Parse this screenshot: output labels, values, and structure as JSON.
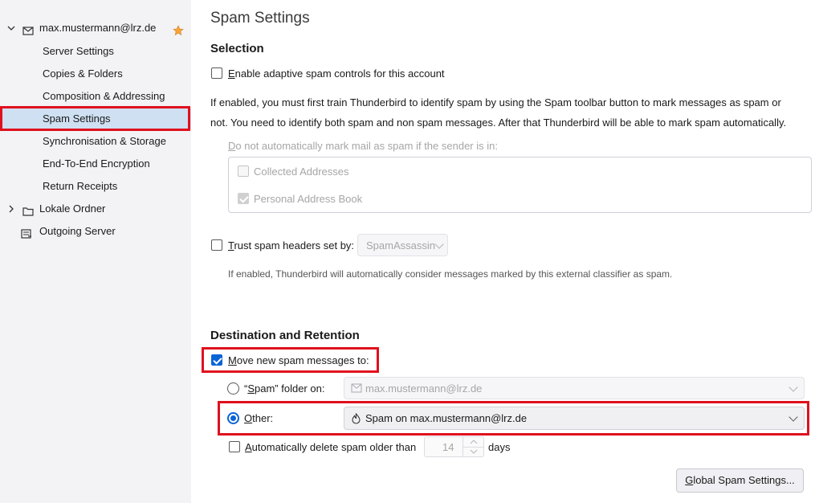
{
  "sidebar": {
    "account": "max.mustermann@lrz.de",
    "items": [
      {
        "label": "Server Settings"
      },
      {
        "label": "Copies & Folders"
      },
      {
        "label": "Composition & Addressing"
      },
      {
        "label": "Spam Settings"
      },
      {
        "label": "Synchronisation & Storage"
      },
      {
        "label": "End-To-End Encryption"
      },
      {
        "label": "Return Receipts"
      }
    ],
    "local_folders": "Lokale Ordner",
    "outgoing_server": "Outgoing Server"
  },
  "page": {
    "title": "Spam Settings",
    "selection": {
      "heading": "Selection",
      "enable_adaptive_prefix": "E",
      "enable_adaptive_rest": "nable adaptive spam controls for this account",
      "desc_line1": "If enabled, you must first train Thunderbird to identify spam by using the Spam toolbar button to mark messages as spam or",
      "desc_line2": "not. You need to identify both spam and non spam messages. After that Thunderbird will be able to mark spam automatically.",
      "whitelist_prefix": "D",
      "whitelist_rest": "o not automatically mark mail as spam if the sender is in:",
      "collected": "Collected Addresses",
      "personal": "Personal Address Book",
      "trust_prefix": "T",
      "trust_rest": "rust spam headers set by:",
      "trust_select": "SpamAssassin",
      "trust_desc": "If enabled, Thunderbird will automatically consider messages marked by this external classifier as spam."
    },
    "destination": {
      "heading": "Destination and Retention",
      "move_prefix": "M",
      "move_rest": "ove new spam messages to:",
      "spam_folder_pre": "“",
      "spam_folder_u": "S",
      "spam_folder_rest": "pam” folder on:",
      "spam_folder_select": "max.mustermann@lrz.de",
      "other_u": "O",
      "other_rest": "ther:",
      "other_select": "Spam on max.mustermann@lrz.de",
      "auto_delete_pre": "A",
      "auto_delete_rest": "utomatically delete spam older than",
      "days_value": "14",
      "days_label": "days",
      "global_btn_u": "G",
      "global_btn_rest": "lobal Spam Settings..."
    }
  },
  "colors": {
    "highlight": "#e0101d",
    "accent": "#0a64d6",
    "selected_row": "#cfe0f2"
  }
}
